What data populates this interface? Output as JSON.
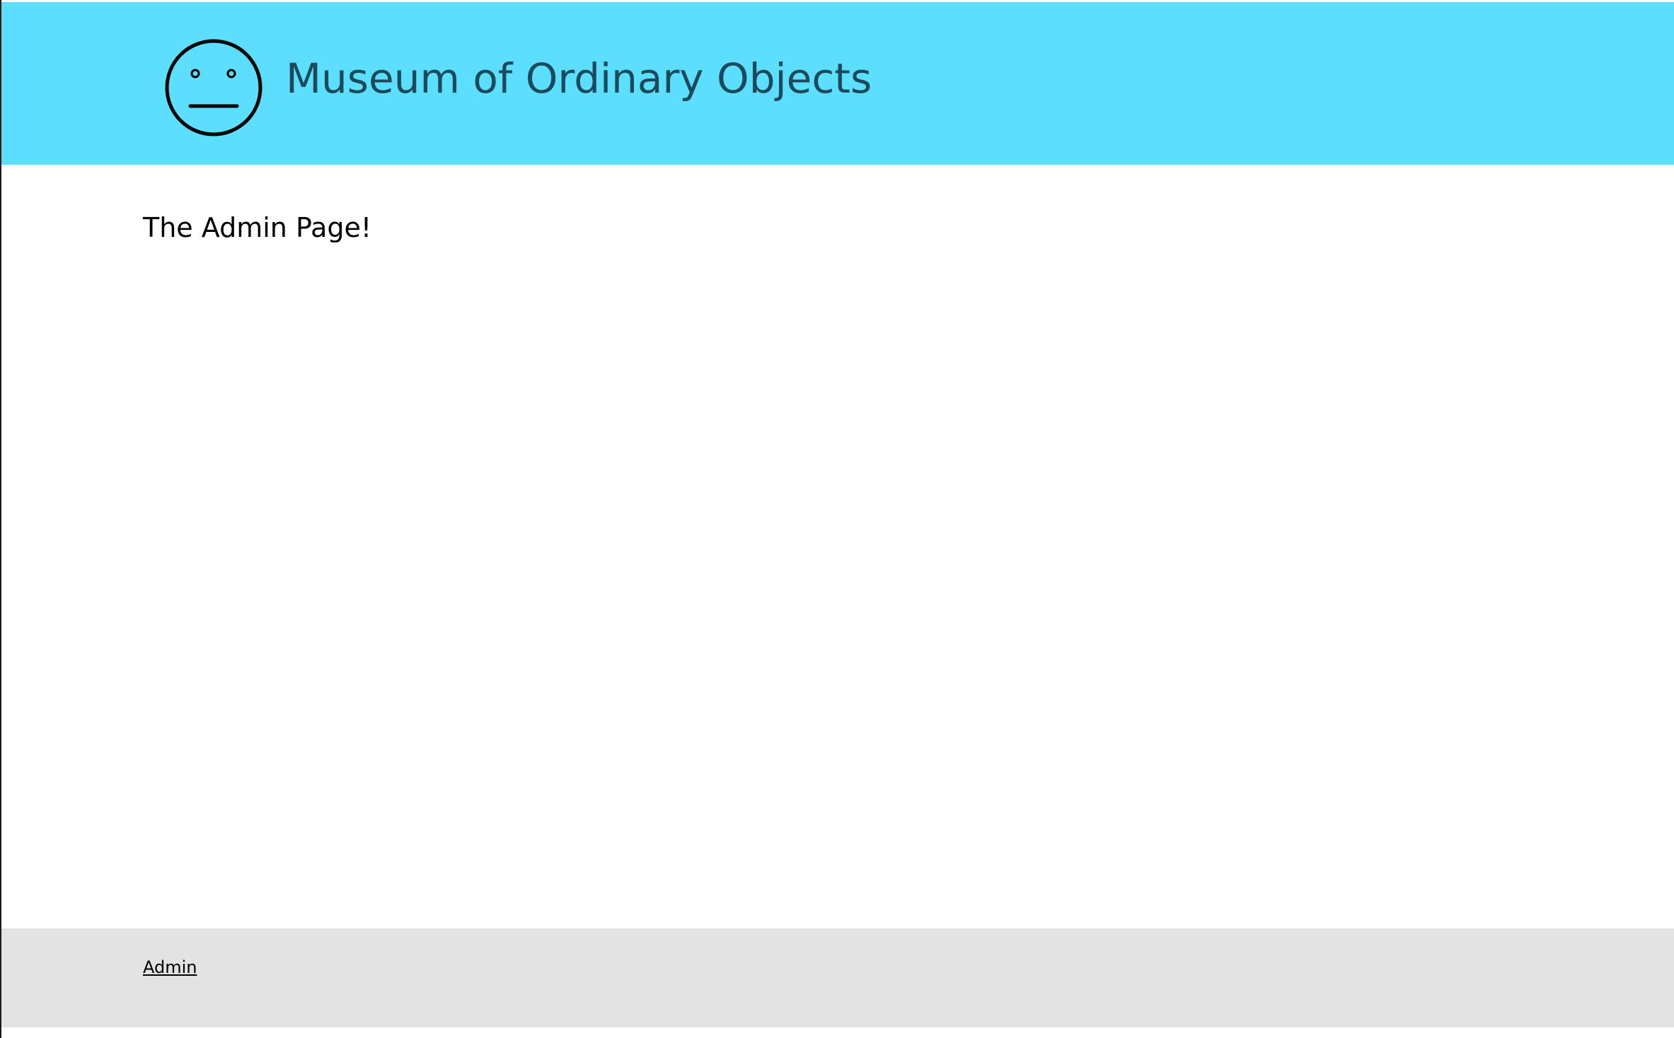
{
  "header": {
    "site_title": "Museum of Ordinary Objects",
    "logo_icon": "neutral-face-icon",
    "background_color": "#5cdeff",
    "title_color": "#1d4a5a"
  },
  "main": {
    "heading": "The Admin Page!"
  },
  "footer": {
    "admin_link": "Admin",
    "background_color": "#e3e3e3"
  }
}
